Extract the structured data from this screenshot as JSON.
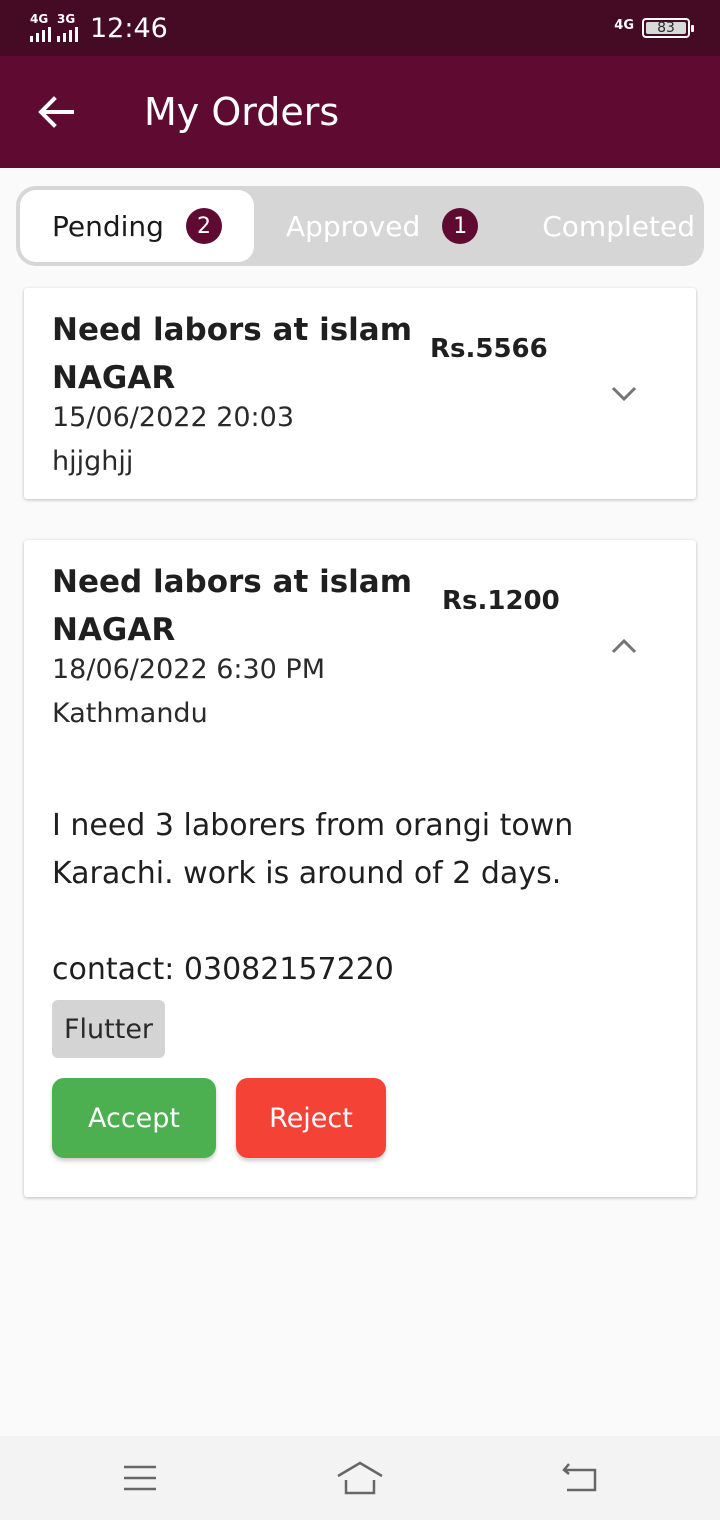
{
  "status_bar": {
    "signal_1": "4G",
    "signal_2": "3G",
    "time": "12:46",
    "network": "4G",
    "battery": "83"
  },
  "app_bar": {
    "title": "My Orders",
    "back_icon": "arrow-left-icon"
  },
  "tabs": [
    {
      "label": "Pending",
      "badge": "2",
      "active": true
    },
    {
      "label": "Approved",
      "badge": "1",
      "active": false
    },
    {
      "label": "Completed",
      "active": false
    }
  ],
  "orders": [
    {
      "title": "Need labors at islam NAGAR",
      "price": "Rs.5566",
      "datetime": "15/06/2022 20:03",
      "location": "hjjghjj",
      "expanded": false,
      "chevron_icon": "chevron-down-icon"
    },
    {
      "title": "Need labors at islam NAGAR",
      "price": "Rs.1200",
      "datetime": "18/06/2022 6:30 PM",
      "location": "Kathmandu",
      "expanded": true,
      "chevron_icon": "chevron-up-icon",
      "description": "I need 3 laborers from orangi town Karachi. work is around of 2 days.\n\ncontact: 03082157220",
      "skill_tag": "Flutter",
      "accept_label": "Accept",
      "reject_label": "Reject"
    }
  ],
  "colors": {
    "status_bar": "#450a24",
    "app_bar": "#5f0b31",
    "badge": "#5f0b31",
    "accept": "#4caf50",
    "reject": "#f44336"
  },
  "system_nav": [
    "menu-icon",
    "home-icon",
    "back-icon"
  ]
}
